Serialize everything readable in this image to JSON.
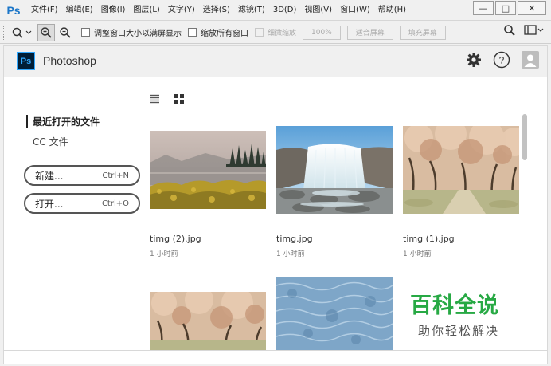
{
  "app": {
    "logo": "Ps",
    "name": "Photoshop"
  },
  "menu": [
    "文件(F)",
    "编辑(E)",
    "图像(I)",
    "图层(L)",
    "文字(Y)",
    "选择(S)",
    "滤镜(T)",
    "3D(D)",
    "视图(V)",
    "窗口(W)",
    "帮助(H)"
  ],
  "window_controls": {
    "minimize": "—",
    "maximize": "□",
    "close": "✕"
  },
  "options_bar": {
    "resize_windows": "调整窗口大小以满屏显示",
    "zoom_all_windows": "缩放所有窗口",
    "scrubby_zoom": "细微缩放",
    "zoom_percent": "100%",
    "fit_screen": "适合屏幕",
    "fill_screen": "填充屏幕"
  },
  "sidebar": {
    "recent_files": "最近打开的文件",
    "cc_files": "CC 文件",
    "new_button": {
      "label": "新建...",
      "shortcut": "Ctrl+N"
    },
    "open_button": {
      "label": "打开...",
      "shortcut": "Ctrl+O"
    }
  },
  "files": [
    {
      "name": "timg (2).jpg",
      "time": "1 小时前"
    },
    {
      "name": "timg.jpg",
      "time": "1 小时前"
    },
    {
      "name": "timg (1).jpg",
      "time": "1 小时前"
    }
  ],
  "watermark": {
    "title": "百科全说",
    "subtitle": "助你轻松解决"
  },
  "colors": {
    "ps_blue": "#31a8ff",
    "ps_dark": "#001e36",
    "watermark_green": "#27a944"
  }
}
